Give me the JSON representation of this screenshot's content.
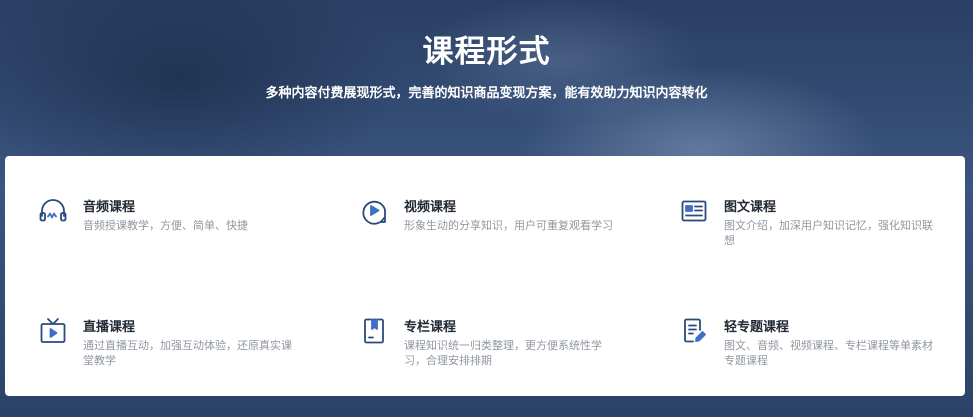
{
  "header": {
    "title": "课程形式",
    "subtitle": "多种内容付费展现形式，完善的知识商品变现方案，能有效助力知识内容转化"
  },
  "courses": [
    {
      "name": "音频课程",
      "desc": "音频授课教学，方便、简单、快捷",
      "icon": "headphones-icon"
    },
    {
      "name": "视频课程",
      "desc": "形象生动的分享知识，用户可重复观看学习",
      "icon": "video-play-icon"
    },
    {
      "name": "图文课程",
      "desc": "图文介绍，加深用户知识记忆，强化知识联想",
      "icon": "image-text-icon"
    },
    {
      "name": "直播课程",
      "desc": "通过直播互动，加强互动体验，还原真实课堂教学",
      "icon": "live-tv-icon"
    },
    {
      "name": "专栏课程",
      "desc": "课程知识统一归类整理，更方便系统性学习，合理安排排期",
      "icon": "column-book-icon"
    },
    {
      "name": "轻专题课程",
      "desc": "图文、音频、视频课程、专栏课程等单素材专题课程",
      "icon": "document-edit-icon"
    }
  ],
  "colors": {
    "accent": "#3f6fc4",
    "icon_dark": "#2a4a7e",
    "card_bg": "#ffffff",
    "hero_bg": "#2f4468"
  }
}
